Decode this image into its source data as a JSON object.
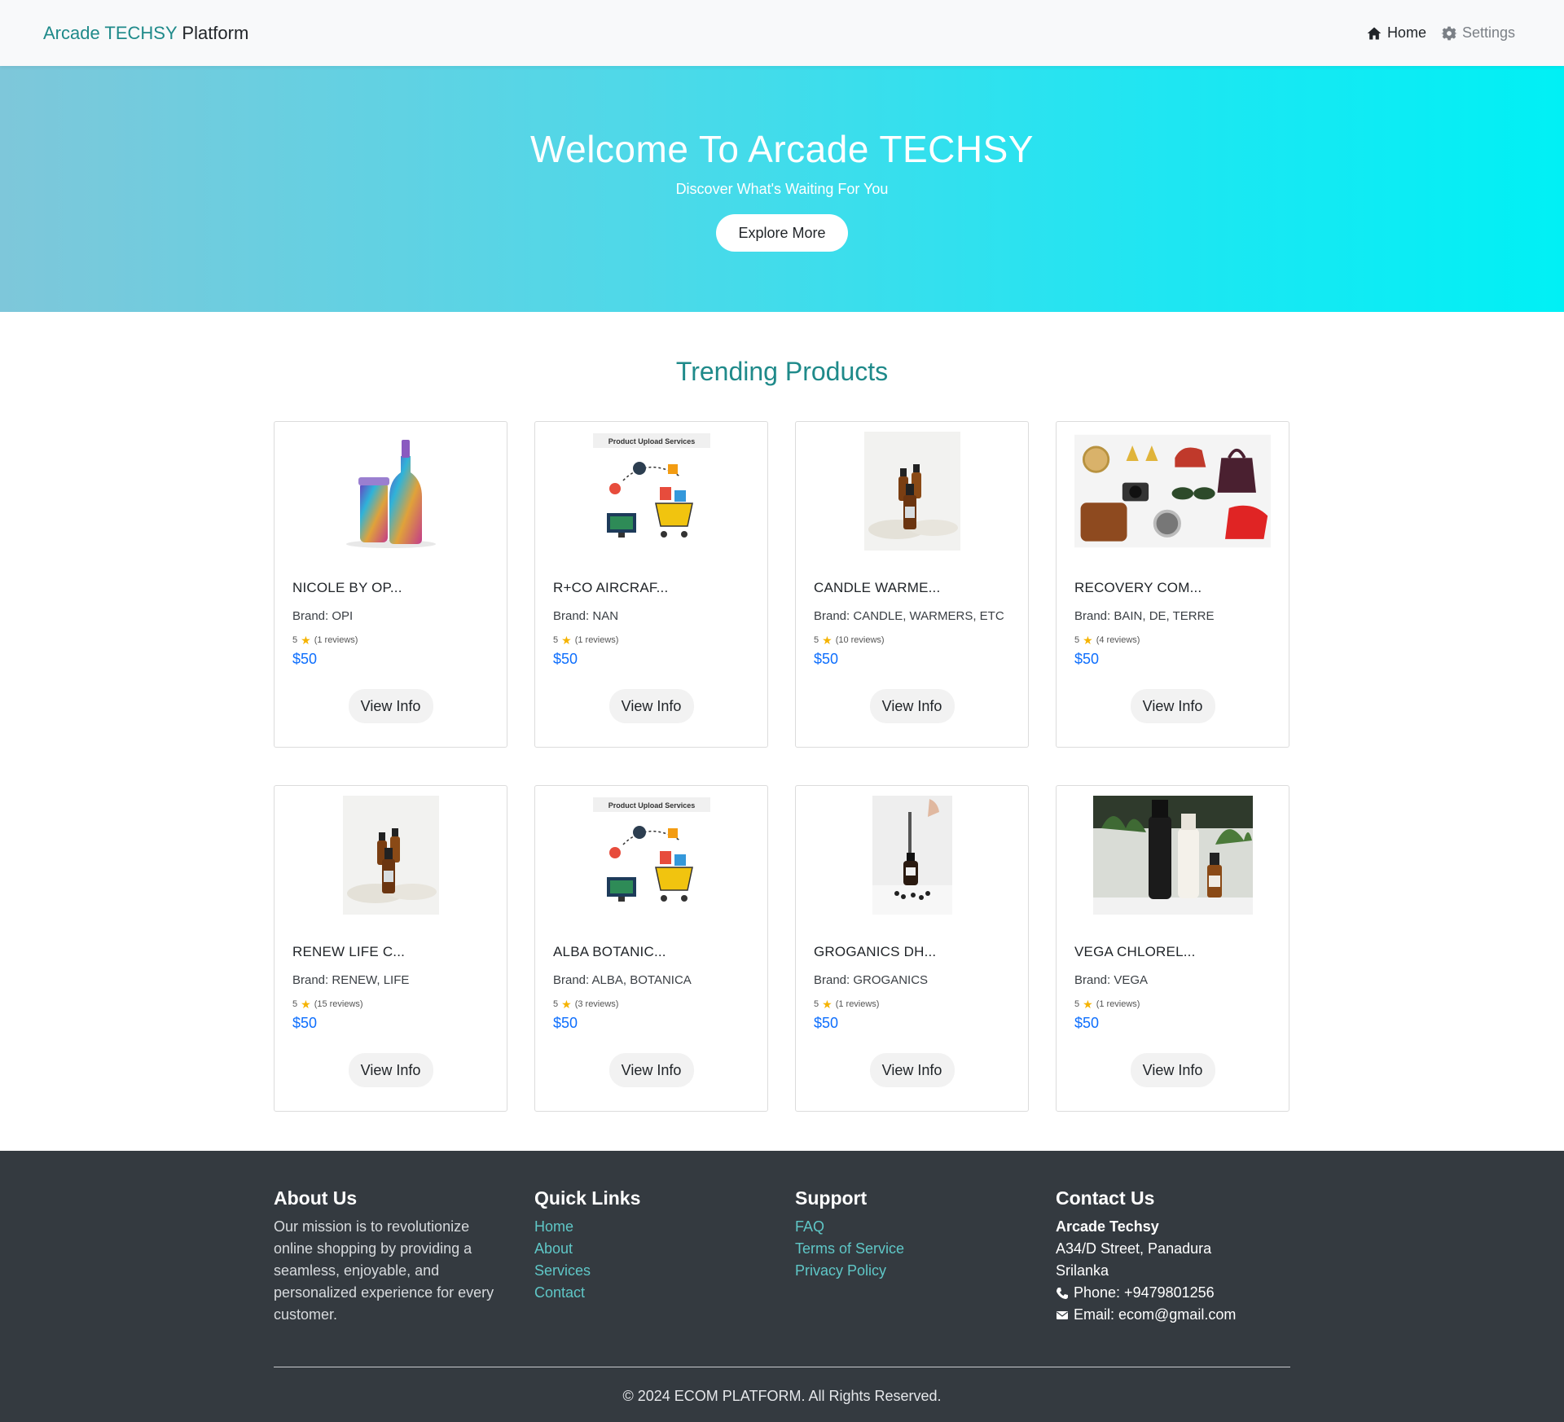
{
  "navbar": {
    "brand_accent": "Arcade TECHSY",
    "brand_rest": "Platform",
    "home_label": "Home",
    "settings_label": "Settings",
    "home_icon": "home-icon",
    "settings_icon": "gear-icon"
  },
  "hero": {
    "title": "Welcome To Arcade TECHSY",
    "subtitle": "Discover What's Waiting For You",
    "button_label": "Explore More"
  },
  "products": {
    "title": "Trending Products",
    "items": [
      {
        "name": "NICOLE BY OP...",
        "brand": "Brand: OPI",
        "rating": "5",
        "reviews": "(1 reviews)",
        "price": "$50",
        "button": "View Info",
        "image": "bottles-image"
      },
      {
        "name": "R+CO AIRCRAF...",
        "brand": "Brand: NAN",
        "rating": "5",
        "reviews": "(1 reviews)",
        "price": "$50",
        "button": "View Info",
        "image": "upload-services-image",
        "image_caption": "Product Upload Services"
      },
      {
        "name": "CANDLE WARME...",
        "brand": "Brand: CANDLE, WARMERS, ETC",
        "rating": "5",
        "reviews": "(10 reviews)",
        "price": "$50",
        "button": "View Info",
        "image": "serum-bottles-image"
      },
      {
        "name": "RECOVERY COM...",
        "brand": "Brand: BAIN, DE, TERRE",
        "rating": "5",
        "reviews": "(4 reviews)",
        "price": "$50",
        "button": "View Info",
        "image": "accessories-collage-image"
      },
      {
        "name": "RENEW LIFE C...",
        "brand": "Brand: RENEW, LIFE",
        "rating": "5",
        "reviews": "(15 reviews)",
        "price": "$50",
        "button": "View Info",
        "image": "serum-bottles-image"
      },
      {
        "name": "ALBA BOTANIC...",
        "brand": "Brand: ALBA, BOTANICA",
        "rating": "5",
        "reviews": "(3 reviews)",
        "price": "$50",
        "button": "View Info",
        "image": "upload-services-image",
        "image_caption": "Product Upload Services"
      },
      {
        "name": "GROGANICS DH...",
        "brand": "Brand: GROGANICS",
        "rating": "5",
        "reviews": "(1 reviews)",
        "price": "$50",
        "button": "View Info",
        "image": "dropper-bottle-image"
      },
      {
        "name": "VEGA CHLOREL...",
        "brand": "Brand: VEGA",
        "rating": "5",
        "reviews": "(1 reviews)",
        "price": "$50",
        "button": "View Info",
        "image": "haircare-bottles-image"
      }
    ]
  },
  "footer": {
    "about": {
      "title": "About Us",
      "text": "Our mission is to revolutionize online shopping by providing a seamless, enjoyable, and personalized experience for every customer."
    },
    "quick_links": {
      "title": "Quick Links",
      "links": [
        "Home",
        "About",
        "Services",
        "Contact"
      ]
    },
    "support": {
      "title": "Support",
      "links": [
        "FAQ",
        "Terms of Service",
        "Privacy Policy"
      ]
    },
    "contact": {
      "title": "Contact Us",
      "company": "Arcade Techsy",
      "address_line1": "A34/D Street, Panadura",
      "address_line2": "Srilanka",
      "phone": "Phone: +9479801256",
      "email": "Email: ecom@gmail.com"
    },
    "copyright": "© 2024 ECOM PLATFORM. All Rights Reserved."
  },
  "colors": {
    "accent": "#1f8a8a",
    "price": "#0d6efd",
    "footer_bg": "#343a40",
    "link": "#5fc7c7",
    "star": "#f5b301"
  }
}
